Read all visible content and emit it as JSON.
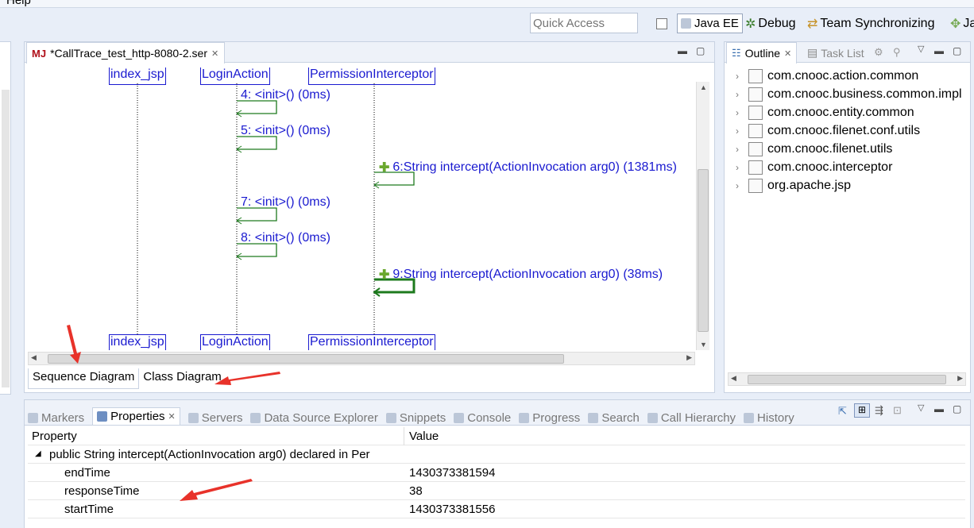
{
  "menu": {
    "help_label": "Help"
  },
  "toolbar": {
    "quick_access_placeholder": "Quick Access",
    "perspectives": [
      "Java EE",
      "Debug",
      "Team Synchronizing",
      "Ja"
    ]
  },
  "editor": {
    "tab_icon_text": "MJ",
    "tab_title": "*CallTrace_test_http-8080-2.ser",
    "lifelines": [
      "index_jsp",
      "LoginAction",
      "PermissionInterceptor"
    ],
    "messages": [
      "4: <init>() (0ms)",
      "5: <init>() (0ms)",
      "6:String intercept(ActionInvocation arg0) (1381ms)",
      "7: <init>() (0ms)",
      "8: <init>() (0ms)",
      "9:String intercept(ActionInvocation arg0) (38ms)"
    ],
    "bottom_tabs": [
      "Sequence Diagram",
      "Class Diagram"
    ]
  },
  "outline": {
    "tabs": [
      "Outline",
      "Task List"
    ],
    "items": [
      "com.cnooc.action.common",
      "com.cnooc.business.common.impl",
      "com.cnooc.entity.common",
      "com.cnooc.filenet.conf.utils",
      "com.cnooc.filenet.utils",
      "com.cnooc.interceptor",
      "org.apache.jsp"
    ]
  },
  "bottom_panel": {
    "tabs": [
      "Markers",
      "Properties",
      "Servers",
      "Data Source Explorer",
      "Snippets",
      "Console",
      "Progress",
      "Search",
      "Call Hierarchy",
      "History"
    ],
    "columns": [
      "Property",
      "Value"
    ],
    "group": "public String intercept(ActionInvocation arg0) declared in Per",
    "rows": [
      {
        "property": "endTime",
        "value": "1430373381594"
      },
      {
        "property": "responseTime",
        "value": "38"
      },
      {
        "property": "startTime",
        "value": "1430373381556"
      }
    ]
  },
  "colors": {
    "arrow_annotation": "#e8322a",
    "lifeline_blue": "#1a1ad0",
    "message_green": "#1d7a1d"
  }
}
